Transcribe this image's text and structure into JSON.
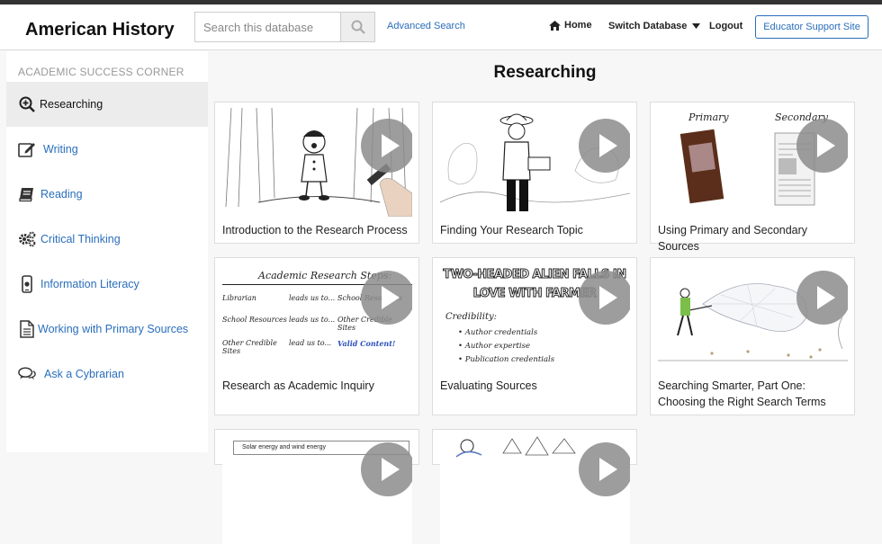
{
  "header": {
    "app_title": "American History",
    "search_placeholder": "Search this database",
    "advanced_search": "Advanced Search",
    "home": "Home",
    "switch_database": "Switch Database",
    "logout": "Logout",
    "educator_support": "Educator Support Site"
  },
  "sidebar": {
    "heading": "ACADEMIC SUCCESS CORNER",
    "items": [
      {
        "label": "Researching",
        "icon": "magnifier-plus-icon",
        "active": true
      },
      {
        "label": "Writing",
        "icon": "pencil-square-icon",
        "active": false
      },
      {
        "label": "Reading",
        "icon": "book-icon",
        "active": false
      },
      {
        "label": "Critical Thinking",
        "icon": "gears-icon",
        "active": false
      },
      {
        "label": "Information Literacy",
        "icon": "mobile-device-icon",
        "active": false
      },
      {
        "label": "Working with Primary Sources",
        "icon": "document-icon",
        "active": false
      },
      {
        "label": "Ask a Cybrarian",
        "icon": "chat-bubbles-icon",
        "active": false
      }
    ]
  },
  "main": {
    "title": "Researching",
    "videos": [
      {
        "title": "Introduction to the Research Process"
      },
      {
        "title": "Finding Your Research Topic"
      },
      {
        "title": "Using Primary and Secondary Sources",
        "thumb_labels": [
          "Primary",
          "Secondary"
        ]
      },
      {
        "title": "Research as Academic Inquiry",
        "thumb_heading": "Academic Research Steps:",
        "thumb_rows": [
          [
            "Librarian",
            "leads us to...",
            "School Resources"
          ],
          [
            "School Resources",
            "leads us to...",
            "Other Credible Sites"
          ],
          [
            "Other Credible Sites",
            "lead us to...",
            "Valid Content!"
          ]
        ]
      },
      {
        "title": "Evaluating Sources",
        "thumb_headline": "TWO-HEADED ALIEN FALLS IN LOVE WITH FARMER",
        "thumb_heading": "Credibility:",
        "thumb_bullets": [
          "Author credentials",
          "Author expertise",
          "Publication credentials"
        ]
      },
      {
        "title": "Searching Smarter, Part One: Choosing the Right Search Terms"
      },
      {
        "title": "",
        "thumb_search": "Solar energy and wind energy"
      },
      {
        "title": ""
      }
    ]
  },
  "colors": {
    "link": "#2a6ebb",
    "topbar": "#333333"
  }
}
